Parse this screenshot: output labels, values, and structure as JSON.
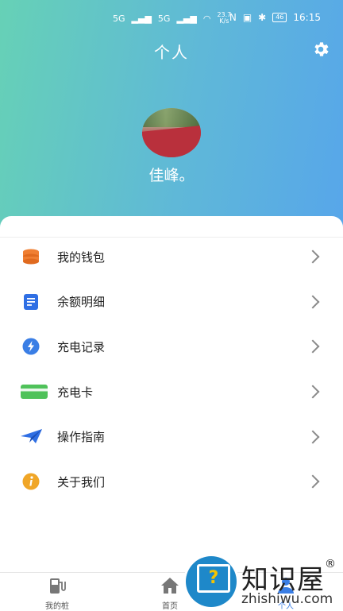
{
  "status_bar": {
    "net1": "5G",
    "net2": "5G",
    "speed_value": "23.7",
    "speed_unit": "K/s",
    "battery": "46",
    "time": "16:15"
  },
  "header": {
    "title": "个人",
    "username": "佳峰。"
  },
  "menu": [
    {
      "label": "我的钱包",
      "icon": "wallet-icon",
      "color": "#f07f32"
    },
    {
      "label": "余额明细",
      "icon": "document-icon",
      "color": "#2f6fe4"
    },
    {
      "label": "充电记录",
      "icon": "lightning-icon",
      "color": "#3a7ee5"
    },
    {
      "label": "充电卡",
      "icon": "card-icon",
      "color": "#4fc25a"
    },
    {
      "label": "操作指南",
      "icon": "paper-plane-icon",
      "color": "#2f6fe4"
    },
    {
      "label": "关于我们",
      "icon": "info-icon",
      "color": "#f0a627"
    }
  ],
  "tabs": [
    {
      "label": "我的桩",
      "icon": "charger-icon"
    },
    {
      "label": "首页",
      "icon": "home-icon"
    },
    {
      "label": "个人",
      "icon": "person-icon"
    }
  ],
  "watermark": {
    "text_cn": "知识屋",
    "text_en": "zhishiwu.com",
    "mark": "®"
  },
  "colors": {
    "header_start": "#66d1b6",
    "header_end": "#57a6ea",
    "accent": "#3a7ee5"
  }
}
